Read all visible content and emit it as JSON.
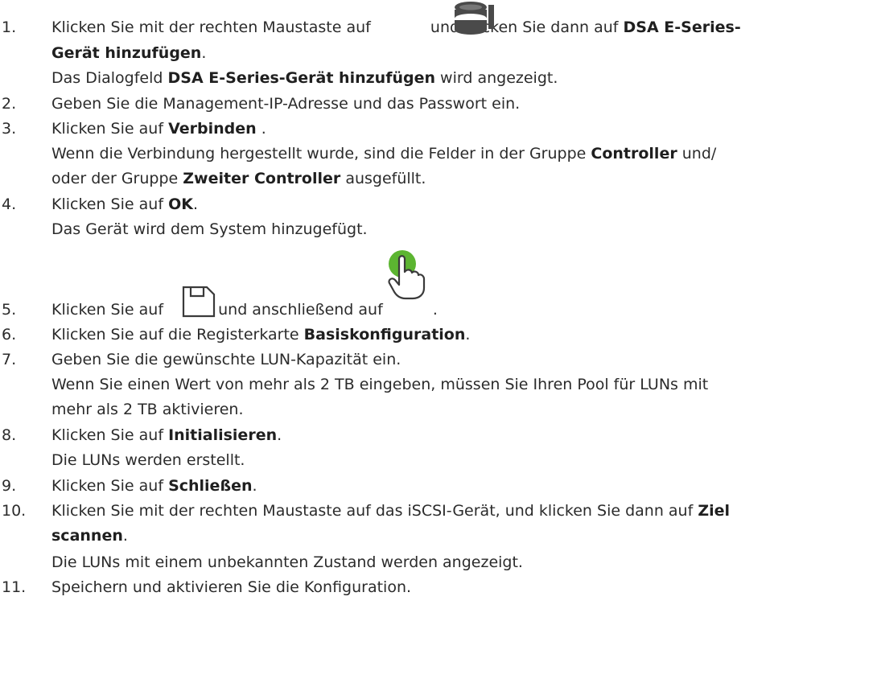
{
  "steps": [
    {
      "num": "1.",
      "a": "Klicken Sie mit der rechten Maustaste auf",
      "b": "und klicken Sie dann auf",
      "c": "DSA E-Series-",
      "d": "Gerät hinzufügen",
      "e": ".",
      "f": "Das Dialogfeld",
      "g": "DSA E-Series-Gerät hinzufügen",
      "h": "wird angezeigt.",
      "icon": "storage-device-icon"
    },
    {
      "num": "2.",
      "a": "Geben Sie die Management-IP-Adresse und das Passwort ein."
    },
    {
      "num": "3.",
      "a": "Klicken Sie auf",
      "b": "Verbinden",
      "c": ".",
      "d": "Wenn die Verbindung hergestellt wurde, sind die Felder in der Gruppe",
      "e": "Controller",
      "f": "und/",
      "g": "oder der Gruppe",
      "h": "Zweiter Controller",
      "i": "ausgefüllt."
    },
    {
      "num": "4.",
      "a": "Klicken Sie auf",
      "b": "OK",
      "c": ".",
      "d": "Das Gerät wird dem System hinzugefügt."
    },
    {
      "num": "5.",
      "a": "Klicken Sie auf",
      "b": "und anschließend auf",
      "c": ".",
      "icon1": "save-icon",
      "icon2": "activate-hand-icon"
    },
    {
      "num": "6.",
      "a": "Klicken Sie auf die Registerkarte",
      "b": "Basiskonfiguration",
      "c": "."
    },
    {
      "num": "7.",
      "a": "Geben Sie die gewünschte LUN-Kapazität ein.",
      "b": "Wenn Sie einen Wert von mehr als 2 TB eingeben, müssen Sie Ihren Pool für LUNs mit",
      "c": "mehr als 2 TB aktivieren."
    },
    {
      "num": "8.",
      "a": "Klicken Sie auf",
      "b": "Initialisieren",
      "c": ".",
      "d": "Die LUNs werden erstellt."
    },
    {
      "num": "9.",
      "a": "Klicken Sie auf",
      "b": "Schließen",
      "c": "."
    },
    {
      "num": "10.",
      "a": "Klicken Sie mit der rechten Maustaste auf das iSCSI-Gerät, und klicken Sie dann auf",
      "b": "Ziel",
      "c": "scannen",
      "d": ".",
      "e": "Die LUNs mit einem unbekannten Zustand werden angezeigt."
    },
    {
      "num": "11.",
      "a": "Speichern und aktivieren Sie die Konfiguration."
    }
  ],
  "colors": {
    "text": "#2b2b2b",
    "icon_green": "#5cb531",
    "icon_gray": "#4a4a4a"
  }
}
